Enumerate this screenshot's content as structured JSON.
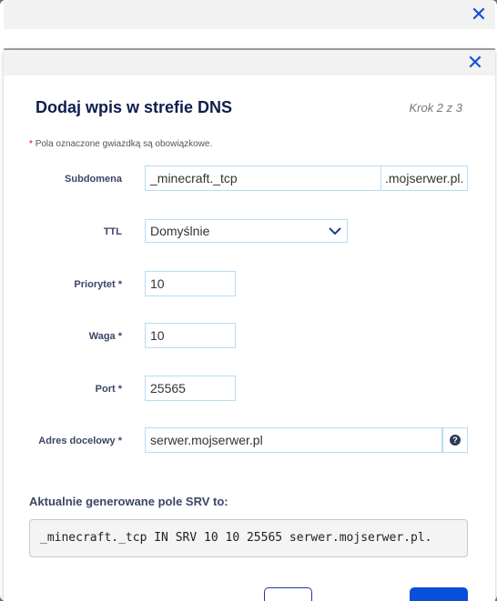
{
  "dialog": {
    "title": "Dodaj wpis w strefie DNS",
    "step": "Krok 2 z 3",
    "required_note_star": "*",
    "required_note": "Pola oznaczone gwiazdką są obowiązkowe.",
    "close_icon": "close-icon"
  },
  "form": {
    "subdomain": {
      "label": "Subdomena",
      "value": "_minecraft._tcp",
      "suffix": ".mojserwer.pl."
    },
    "ttl": {
      "label": "TTL",
      "value": "Domyślnie"
    },
    "priority": {
      "label": "Priorytet *",
      "value": "10"
    },
    "weight": {
      "label": "Waga *",
      "value": "10"
    },
    "port": {
      "label": "Port *",
      "value": "25565"
    },
    "target": {
      "label": "Adres docelowy *",
      "value": "serwer.mojserwer.pl",
      "help_icon": "question-circle-icon"
    }
  },
  "srv": {
    "title": "Aktualnie generowane pole SRV to:",
    "record": "_minecraft._tcp IN SRV 10 10 25565 serwer.mojserwer.pl."
  },
  "colors": {
    "accent": "#0a4fd8",
    "title": "#0f1e4d",
    "label": "#3c4564",
    "input_border": "#b9dcef",
    "required": "#d00000"
  }
}
